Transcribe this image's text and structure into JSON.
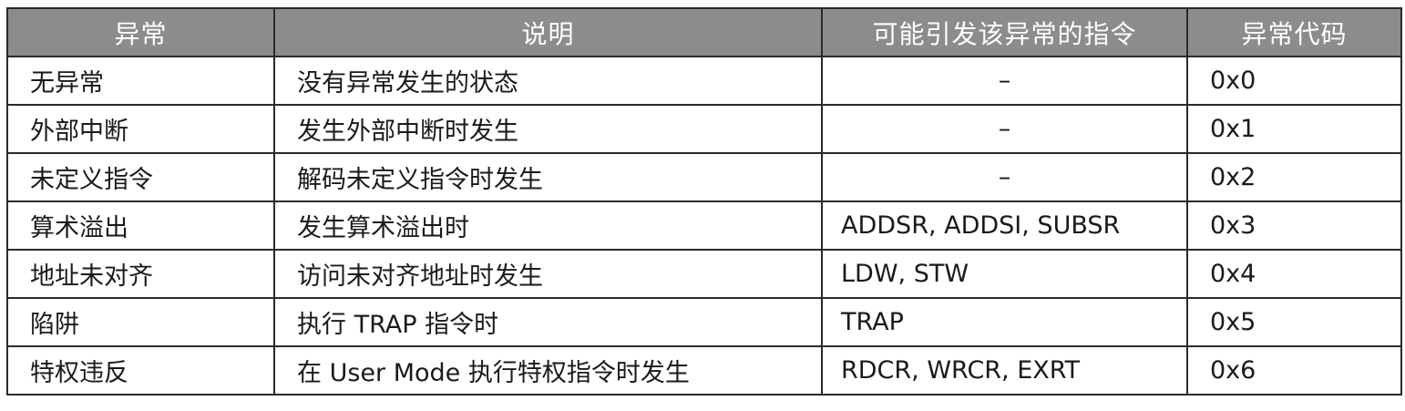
{
  "table": {
    "headers": [
      "异常",
      "说明",
      "可能引发该异常的指令",
      "异常代码"
    ],
    "rows": [
      {
        "name": "无异常",
        "desc": "没有异常发生的状态",
        "inst": "–",
        "code": "0x0"
      },
      {
        "name": "外部中断",
        "desc": "发生外部中断时发生",
        "inst": "–",
        "code": "0x1"
      },
      {
        "name": "未定义指令",
        "desc": "解码未定义指令时发生",
        "inst": "–",
        "code": "0x2"
      },
      {
        "name": "算术溢出",
        "desc": "发生算术溢出时",
        "inst": "ADDSR, ADDSI, SUBSR",
        "code": "0x3"
      },
      {
        "name": "地址未对齐",
        "desc": "访问未对齐地址时发生",
        "inst": "LDW, STW",
        "code": "0x4"
      },
      {
        "name": "陷阱",
        "desc": "执行 TRAP 指令时",
        "inst": "TRAP",
        "code": "0x5"
      },
      {
        "name": "特权违反",
        "desc": "在 User Mode 执行特权指令时发生",
        "inst": "RDCR, WRCR, EXRT",
        "code": "0x6"
      }
    ]
  }
}
